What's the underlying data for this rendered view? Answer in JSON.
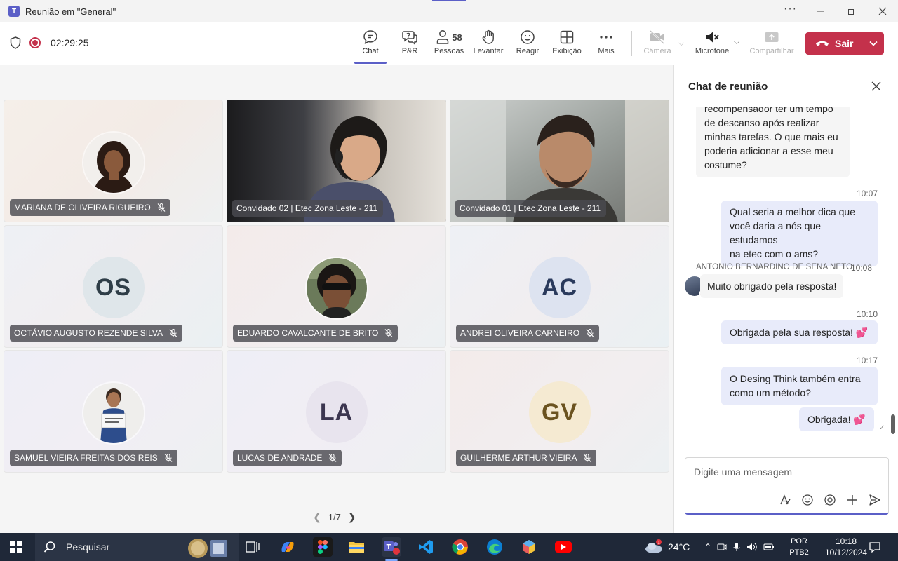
{
  "window": {
    "title": "Reunião em \"General\""
  },
  "meeting_bar": {
    "timer": "02:29:25",
    "buttons": {
      "chat": "Chat",
      "qa": "P&R",
      "people": "Pessoas",
      "people_count": "58",
      "raise_hand": "Levantar",
      "react": "Reagir",
      "view": "Exibição",
      "more": "Mais",
      "camera": "Câmera",
      "mic": "Microfone",
      "share": "Compartilhar",
      "leave": "Sair"
    }
  },
  "participants": [
    {
      "name": "MARIANA DE OLIVEIRA RIGUEIRO",
      "kind": "photo",
      "muted": true
    },
    {
      "name": "Convidado 02 | Etec Zona Leste - 211",
      "kind": "video",
      "muted": false
    },
    {
      "name": "Convidado 01 | Etec Zona Leste - 211",
      "kind": "video",
      "muted": false
    },
    {
      "name": "OCTÁVIO AUGUSTO REZENDE SILVA",
      "kind": "initials",
      "initials": "OS",
      "color": "#dfe6ea",
      "text_color": "#2e3d47",
      "muted": true
    },
    {
      "name": "EDUARDO CAVALCANTE DE BRITO",
      "kind": "photo",
      "muted": true
    },
    {
      "name": "ANDREI OLIVEIRA CARNEIRO",
      "kind": "initials",
      "initials": "AC",
      "color": "#dde3f0",
      "text_color": "#2a3a5c",
      "muted": true
    },
    {
      "name": "SAMUEL VIEIRA FREITAS DOS REIS",
      "kind": "photo",
      "muted": true
    },
    {
      "name": "LUCAS DE ANDRADE",
      "kind": "initials",
      "initials": "LA",
      "color": "#e8e4ee",
      "text_color": "#3c3650",
      "muted": true
    },
    {
      "name": "GUILHERME ARTHUR VIEIRA",
      "kind": "initials",
      "initials": "GV",
      "color": "#f5ead2",
      "text_color": "#6b5320",
      "muted": true
    }
  ],
  "pager": {
    "label": "1/7"
  },
  "chat": {
    "title": "Chat de reunião",
    "messages": [
      {
        "dir": "in",
        "lines": [
          "recompensador ter um tempo",
          "de descanso após realizar",
          "minhas tarefas. O que mais eu",
          "poderia adicionar a esse meu",
          "costume?"
        ]
      },
      {
        "dir": "out",
        "time": "10:07",
        "lines": [
          "Qual seria a melhor dica que",
          "você daria a nós que estudamos",
          "na etec com o ams?"
        ]
      },
      {
        "dir": "in",
        "sender": "ANTONIO BERNARDINO DE SENA NETO",
        "time": "10:08",
        "lines": [
          "Muito obrigado pela resposta!"
        ]
      },
      {
        "dir": "out",
        "time": "10:10",
        "lines": [
          "Obrigada pela sua resposta!"
        ],
        "emoji": "💕"
      },
      {
        "dir": "out",
        "time": "10:17",
        "lines": [
          "O Desing Think também entra",
          "como um método?"
        ]
      },
      {
        "dir": "out",
        "lines": [
          "Obrigada!"
        ],
        "emoji": "💕"
      }
    ],
    "composer_placeholder": "Digite uma mensagem"
  },
  "taskbar": {
    "search_label": "Pesquisar",
    "weather_temp": "24°C",
    "weather_badge": "1",
    "lang_line1": "POR",
    "lang_line2": "PTB2",
    "time": "10:18",
    "date": "10/12/2024"
  },
  "colors": {
    "accent": "#5b5fc7",
    "leave": "#c4314b",
    "taskbar": "#1f2838"
  }
}
